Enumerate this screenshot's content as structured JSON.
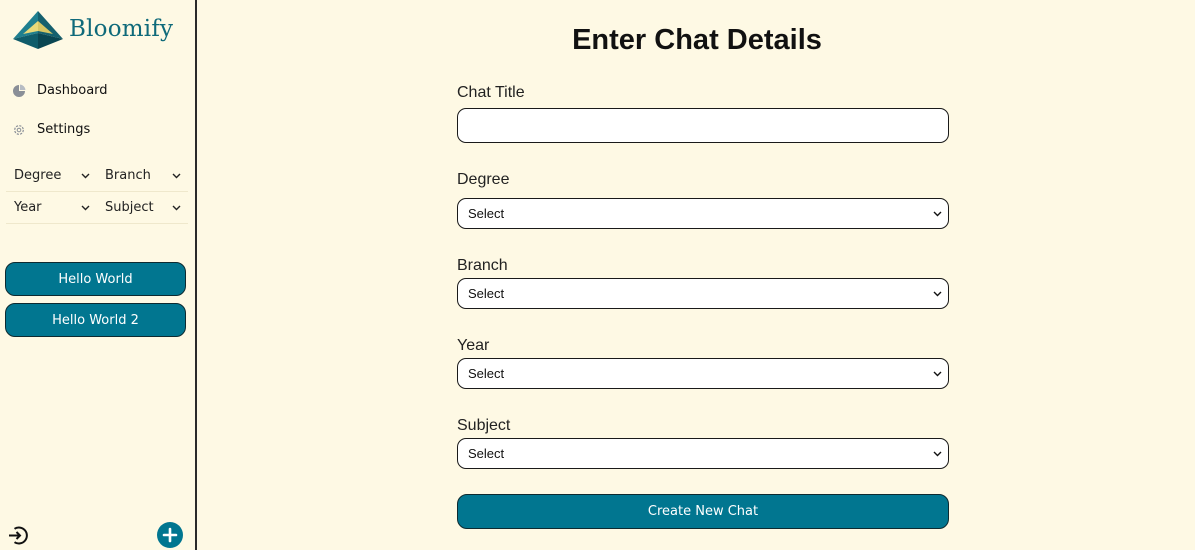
{
  "app": {
    "name": "Bloomify",
    "brand_color": "#0f6a7a",
    "accent_color": "#017690",
    "background_color": "#fef9e4"
  },
  "sidebar": {
    "nav": [
      {
        "label": "Dashboard",
        "icon": "pie-chart-icon"
      },
      {
        "label": "Settings",
        "icon": "gear-icon"
      }
    ],
    "filters": [
      {
        "label": "Degree",
        "icon": "chevron-down-icon"
      },
      {
        "label": "Branch",
        "icon": "chevron-down-icon"
      },
      {
        "label": "Year",
        "icon": "chevron-down-icon"
      },
      {
        "label": "Subject",
        "icon": "chevron-down-icon"
      }
    ],
    "chats": [
      {
        "label": "Hello World"
      },
      {
        "label": "Hello World 2"
      }
    ],
    "footer": {
      "logout_icon": "logout-icon",
      "add_icon": "plus-circle-icon"
    }
  },
  "form": {
    "title": "Enter Chat Details",
    "fields": {
      "chat_title": {
        "label": "Chat Title",
        "value": "",
        "placeholder": ""
      },
      "degree": {
        "label": "Degree",
        "value": "Select"
      },
      "branch": {
        "label": "Branch",
        "value": "Select"
      },
      "year": {
        "label": "Year",
        "value": "Select"
      },
      "subject": {
        "label": "Subject",
        "value": "Select"
      }
    },
    "submit_label": "Create New Chat"
  }
}
